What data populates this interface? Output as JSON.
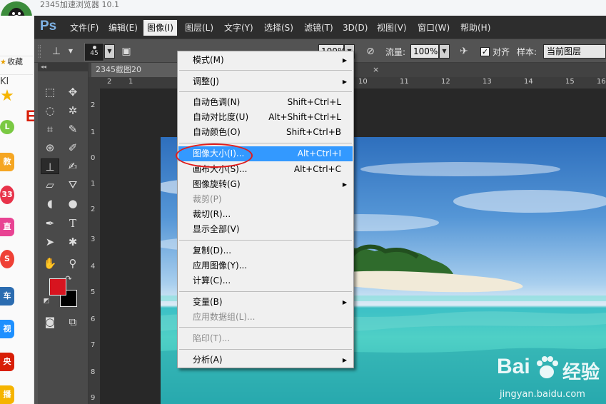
{
  "browser": {
    "title": "2345加速浏览器 10.1",
    "favorites_label": "收藏",
    "tab_stub": "KI",
    "side_items": [
      {
        "icon": "star-icon",
        "color": "#f5b400"
      },
      {
        "icon": "clock-icon",
        "color": "#7ac943"
      },
      {
        "label": "教育",
        "color": "#f5a623"
      },
      {
        "label": "33",
        "color": "#e8334a"
      },
      {
        "label": "直播",
        "color": "#e84393"
      },
      {
        "label": "S",
        "color": "#ef4136"
      },
      {
        "label": "车讯",
        "color": "#2b6cb0"
      },
      {
        "label": "视频",
        "color": "#1e90ff"
      },
      {
        "label": "央视",
        "color": "#d81e06"
      },
      {
        "label": "播扑",
        "color": "#f5b400"
      }
    ],
    "page_fragment": "E"
  },
  "photoshop": {
    "logo": "Ps",
    "menus": [
      "文件(F)",
      "编辑(E)",
      "图像(I)",
      "图层(L)",
      "文字(Y)",
      "选择(S)",
      "滤镜(T)",
      "3D(D)",
      "视图(V)",
      "窗口(W)",
      "帮助(H)"
    ],
    "active_menu": "图像(I)",
    "options": {
      "brush_size": "45",
      "opacity_value": "100%",
      "flow_label": "流量:",
      "flow_value": "100%",
      "align_checked": true,
      "align_label": "对齐",
      "sample_label": "样本:",
      "sample_value": "当前图层"
    },
    "document": {
      "tab_title": "2345截图20",
      "tab_close": "×",
      "ruler_top": [
        "2",
        "1",
        "10",
        "11",
        "12",
        "13",
        "14",
        "15",
        "16"
      ],
      "ruler_left": [
        "2",
        "1",
        "0",
        "1",
        "2",
        "3",
        "4",
        "5",
        "6",
        "7",
        "8",
        "9"
      ]
    },
    "colors": {
      "foreground": "#d7141f",
      "background": "#000000"
    }
  },
  "image_menu": {
    "items": [
      {
        "label": "模式(M)",
        "submenu": true
      },
      {
        "sep": true
      },
      {
        "label": "调整(J)",
        "submenu": true
      },
      {
        "sep": true
      },
      {
        "label": "自动色调(N)",
        "shortcut": "Shift+Ctrl+L"
      },
      {
        "label": "自动对比度(U)",
        "shortcut": "Alt+Shift+Ctrl+L"
      },
      {
        "label": "自动颜色(O)",
        "shortcut": "Shift+Ctrl+B"
      },
      {
        "sep": true
      },
      {
        "label": "图像大小(I)...",
        "shortcut": "Alt+Ctrl+I",
        "highlighted": true
      },
      {
        "label": "画布大小(S)...",
        "shortcut": "Alt+Ctrl+C"
      },
      {
        "label": "图像旋转(G)",
        "submenu": true
      },
      {
        "label": "裁剪(P)",
        "disabled": true
      },
      {
        "label": "裁切(R)..."
      },
      {
        "label": "显示全部(V)"
      },
      {
        "sep": true
      },
      {
        "label": "复制(D)..."
      },
      {
        "label": "应用图像(Y)..."
      },
      {
        "label": "计算(C)..."
      },
      {
        "sep": true
      },
      {
        "label": "变量(B)",
        "submenu": true
      },
      {
        "label": "应用数据组(L)...",
        "disabled": true
      },
      {
        "sep": true
      },
      {
        "label": "陷印(T)...",
        "disabled": true
      },
      {
        "sep": true
      },
      {
        "label": "分析(A)",
        "submenu": true
      }
    ]
  },
  "watermark": {
    "brand": "Bai",
    "brand_suffix": "经验",
    "url": "jingyan.baidu.com"
  }
}
